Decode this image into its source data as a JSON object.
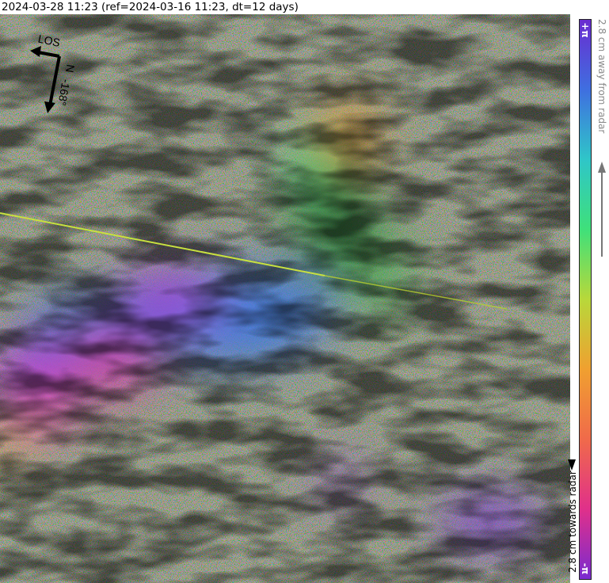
{
  "header": {
    "title": "2024-03-28 11:23 (ref=2024-03-16 11:23, dt=12 days)"
  },
  "map": {
    "los_label": "LOS",
    "north_label": "N",
    "heading_label": "-168°"
  },
  "colorbar": {
    "top_label": "+π",
    "bottom_label": "-π",
    "away_label": "2.8 cm away from radar",
    "towards_label": "2.8 cm towards radar",
    "colors": [
      "#6a2bd0",
      "#3f6fe0",
      "#2fc6c8",
      "#3fe07a",
      "#b8d83a",
      "#f0a030",
      "#f06a4a",
      "#e0308a",
      "#7a2bd0"
    ]
  }
}
